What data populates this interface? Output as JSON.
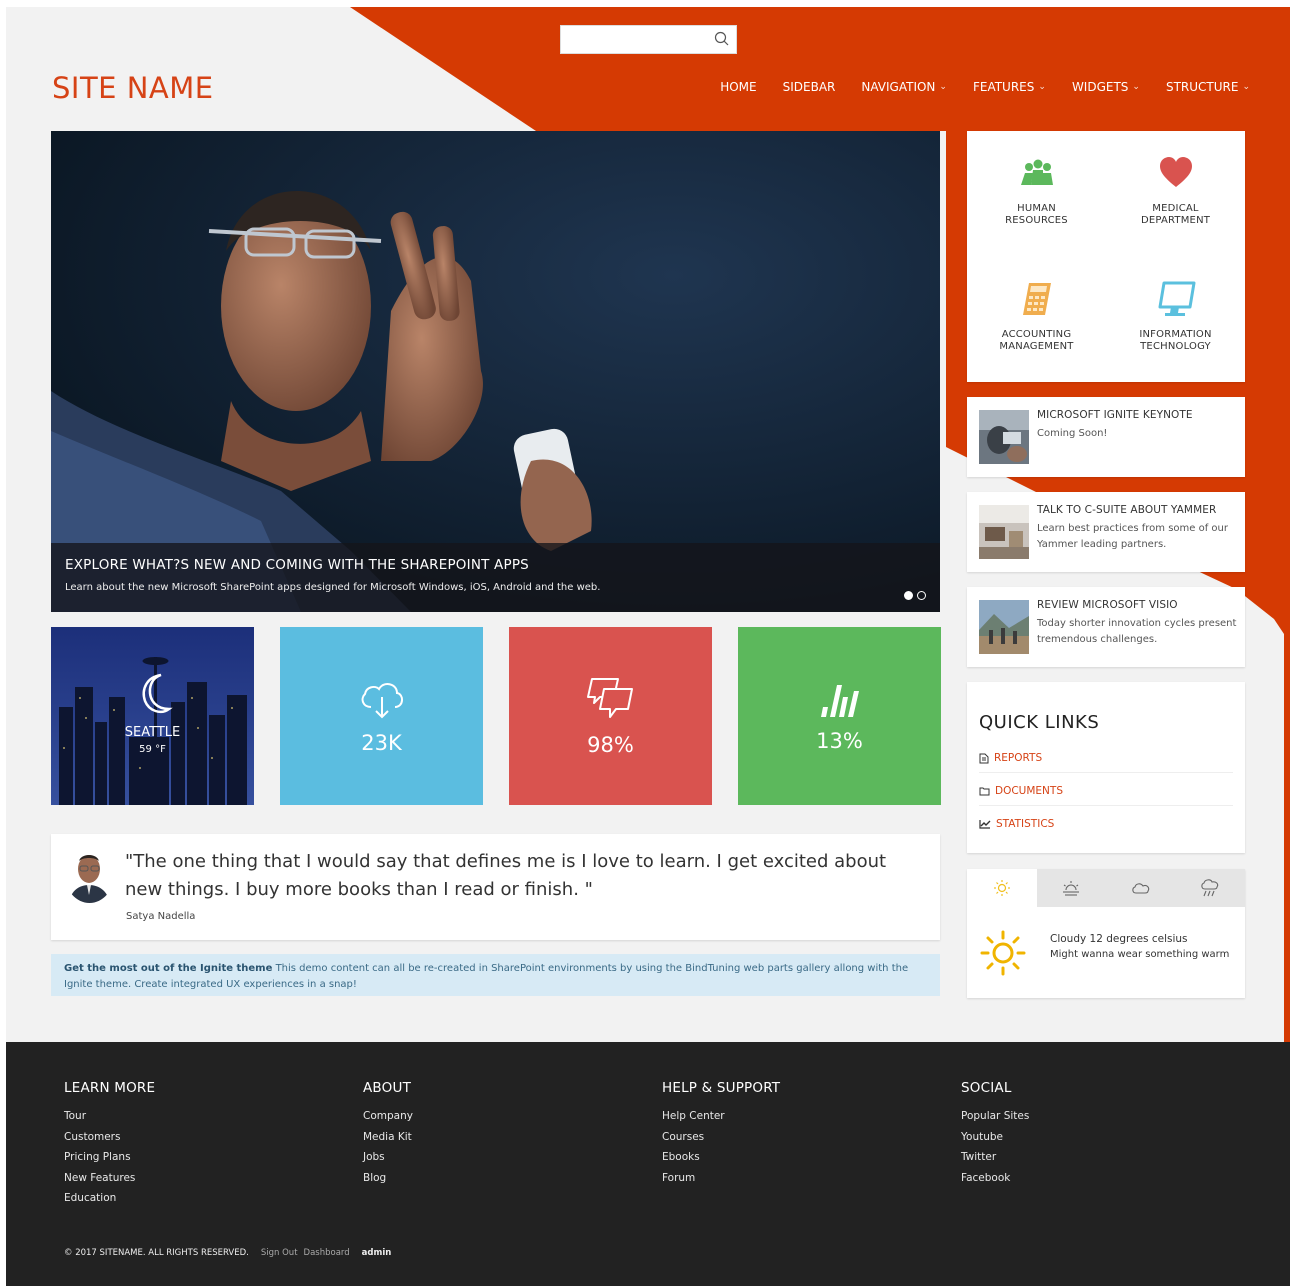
{
  "search": {
    "placeholder": ""
  },
  "header": {
    "site_name": "SITE NAME"
  },
  "nav": [
    {
      "label": "HOME",
      "dropdown": false
    },
    {
      "label": "SIDEBAR",
      "dropdown": false
    },
    {
      "label": "NAVIGATION",
      "dropdown": true
    },
    {
      "label": "FEATURES",
      "dropdown": true
    },
    {
      "label": "WIDGETS",
      "dropdown": true
    },
    {
      "label": "STRUCTURE",
      "dropdown": true
    }
  ],
  "nav_chevron": "⌄",
  "hero": {
    "title": "EXPLORE WHAT?S NEW AND COMING WITH THE SHAREPOINT APPS",
    "subtitle": "Learn about the new Microsoft SharePoint apps designed for Microsoft Windows, iOS, Android and the web.",
    "slides": 2,
    "active_slide": 1
  },
  "tiles": {
    "weather": {
      "city": "SEATTLE",
      "temp": "59 °F",
      "icon": "moon-icon"
    },
    "downloads": {
      "value": "23K",
      "icon": "cloud-download-icon",
      "color": "#5bbde0"
    },
    "comments": {
      "value": "98%",
      "icon": "chat-bubbles-icon",
      "color": "#d9534f"
    },
    "stats": {
      "value": "13%",
      "icon": "bar-chart-icon",
      "color": "#5cb85c"
    }
  },
  "quote": {
    "text": "\"The one thing that I would say that defines me is I love to learn. I get excited about new things. I buy more books than I read or finish. \"",
    "author": "Satya Nadella"
  },
  "info": {
    "bold": "Get the most out of the Ignite theme",
    "text": " This demo content can all be re-created in SharePoint environments by using the BindTuning web parts gallery allong with the Ignite theme. Create integrated UX experiences in a snap!"
  },
  "departments": [
    {
      "line1": "HUMAN",
      "line2": "RESOURCES",
      "icon": "people-icon",
      "color": "#5cb85c"
    },
    {
      "line1": "MEDICAL",
      "line2": "DEPARTMENT",
      "icon": "heart-icon",
      "color": "#d9534f"
    },
    {
      "line1": "ACCOUNTING",
      "line2": "MANAGEMENT",
      "icon": "calculator-icon",
      "color": "#f0ad4e"
    },
    {
      "line1": "INFORMATION",
      "line2": "TECHNOLOGY",
      "icon": "monitor-icon",
      "color": "#5bc0de"
    }
  ],
  "news": [
    {
      "title": "MICROSOFT IGNITE KEYNOTE",
      "desc": "Coming Soon!"
    },
    {
      "title": "TALK TO C-SUITE ABOUT YAMMER",
      "desc": "Learn best practices from some of our Yammer leading partners."
    },
    {
      "title": "REVIEW MICROSOFT VISIO",
      "desc": "Today shorter innovation cycles present tremendous challenges."
    }
  ],
  "quick_links": {
    "title": "QUICK LINKS",
    "items": [
      {
        "label": "REPORTS",
        "icon": "document-icon"
      },
      {
        "label": "DOCUMENTS",
        "icon": "folder-icon"
      },
      {
        "label": "STATISTICS",
        "icon": "line-chart-icon"
      }
    ]
  },
  "weather_widget": {
    "tabs": [
      "sun-icon",
      "sunrise-icon",
      "cloud-icon",
      "rain-icon"
    ],
    "active_tab": 0,
    "line1": "Cloudy 12 degrees celsius",
    "line2": "Might wanna wear something warm"
  },
  "footer": {
    "columns": [
      {
        "heading": "LEARN MORE",
        "links": [
          "Tour",
          "Customers",
          "Pricing Plans",
          "New Features",
          "Education"
        ]
      },
      {
        "heading": "ABOUT",
        "links": [
          "Company",
          "Media Kit",
          "Jobs",
          "Blog"
        ]
      },
      {
        "heading": "HELP & SUPPORT",
        "links": [
          "Help Center",
          "Courses",
          "Ebooks",
          "Forum"
        ]
      },
      {
        "heading": "SOCIAL",
        "links": [
          "Popular Sites",
          "Youtube",
          "Twitter",
          "Facebook"
        ]
      }
    ],
    "copyright": "© 2017 SITENAME. ALL RIGHTS RESERVED.",
    "signout": "Sign Out",
    "dashboard": "Dashboard",
    "user": "admin"
  },
  "colors": {
    "accent": "#d64316",
    "footer_bg": "#222222",
    "info_bg": "#d7eaf5"
  }
}
